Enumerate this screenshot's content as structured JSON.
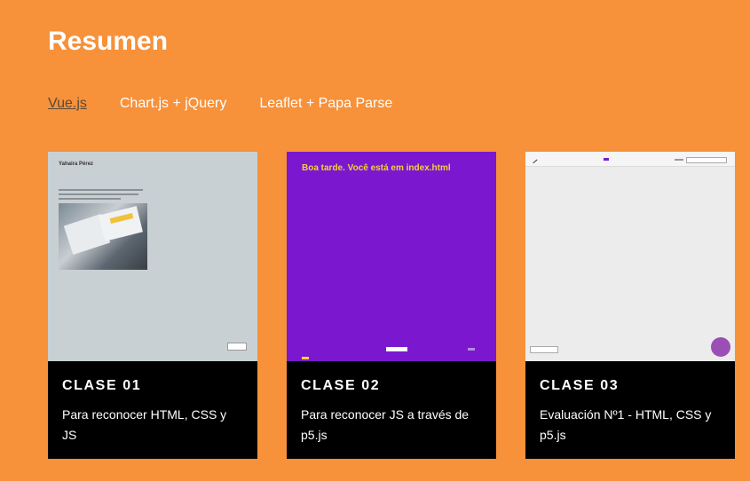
{
  "page": {
    "title": "Resumen"
  },
  "tabs": [
    {
      "label": "Vue.js",
      "active": true
    },
    {
      "label": "Chart.js + jQuery",
      "active": false
    },
    {
      "label": "Leaflet + Papa Parse",
      "active": false
    }
  ],
  "cards": [
    {
      "title": "CLASE 01",
      "description": "Para reconocer HTML, CSS y JS",
      "thumbnail": {
        "heading": "Yahaira Pérez"
      }
    },
    {
      "title": "CLASE 02",
      "description": "Para reconocer JS a través de p5.js",
      "thumbnail": {
        "heading": "Boa tarde. Você está em index.html"
      }
    },
    {
      "title": "CLASE 03",
      "description": "Evaluación Nº1 - HTML, CSS y p5.js",
      "thumbnail": {}
    }
  ],
  "colors": {
    "background": "#f7913a",
    "card": "#000000",
    "purple": "#7b18cf"
  }
}
